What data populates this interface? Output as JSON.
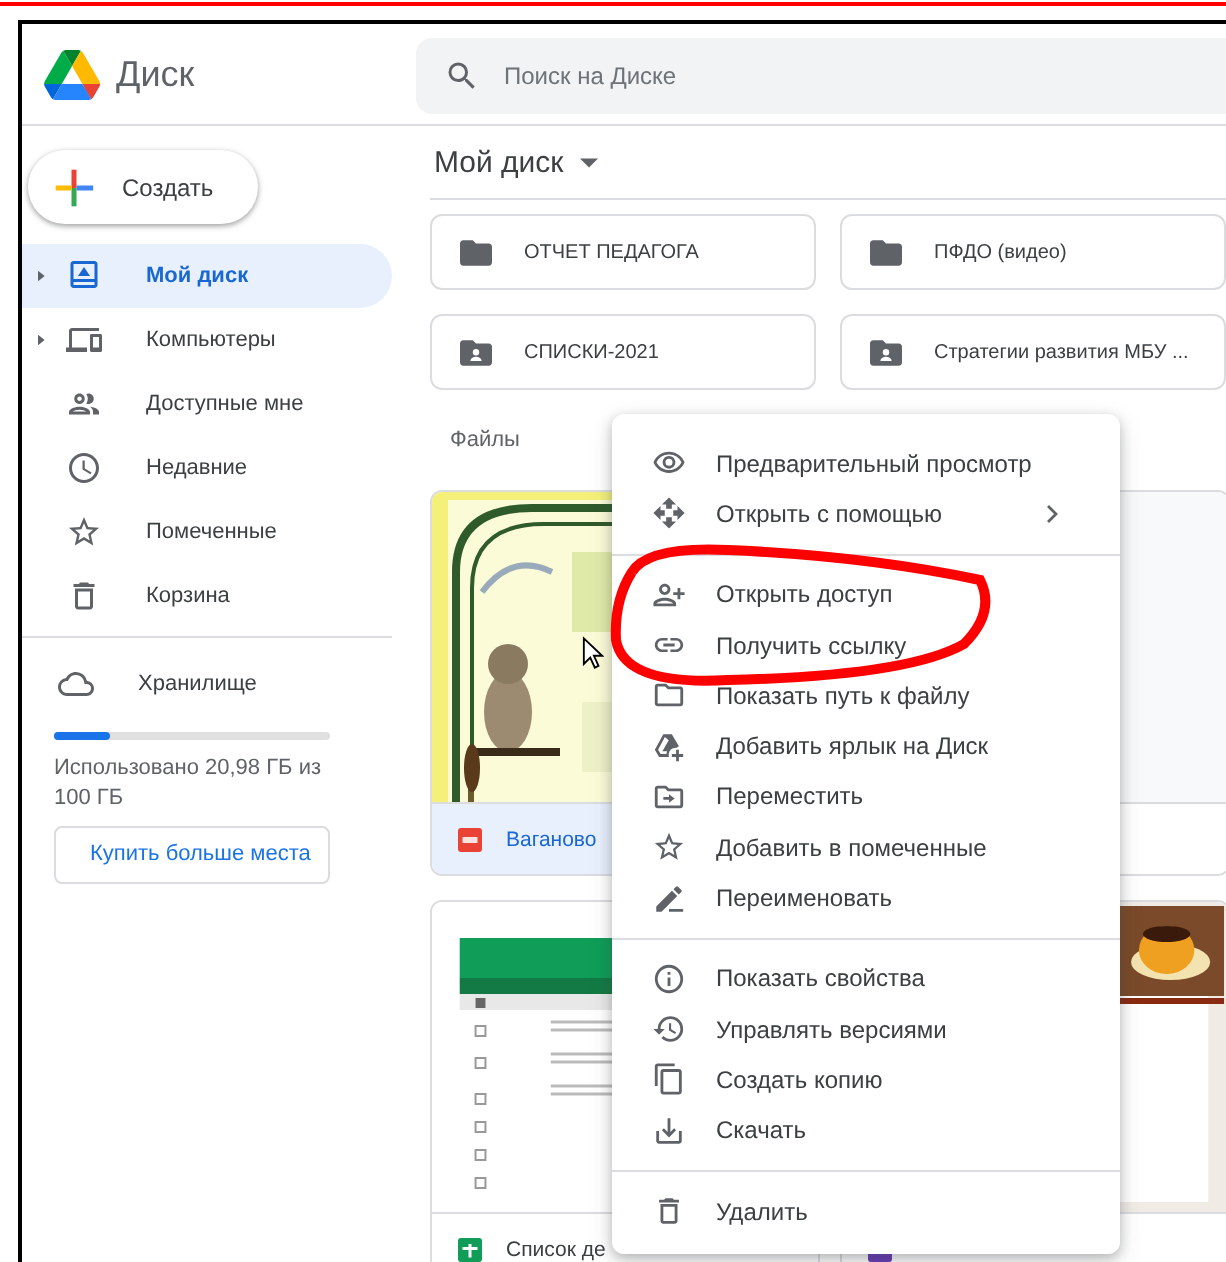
{
  "app": {
    "name": "Диск"
  },
  "search": {
    "placeholder": "Поиск на Диске"
  },
  "create_button": "Создать",
  "nav": [
    {
      "label": "Мой диск",
      "kind": "drive",
      "selected": true,
      "expandable": true
    },
    {
      "label": "Компьютеры",
      "kind": "computers",
      "selected": false,
      "expandable": true
    },
    {
      "label": "Доступные мне",
      "kind": "shared",
      "selected": false,
      "expandable": false
    },
    {
      "label": "Недавние",
      "kind": "recent",
      "selected": false,
      "expandable": false
    },
    {
      "label": "Помеченные",
      "kind": "starred",
      "selected": false,
      "expandable": false
    },
    {
      "label": "Корзина",
      "kind": "trash",
      "selected": false,
      "expandable": false
    }
  ],
  "storage": {
    "label": "Хранилище",
    "level": 0.2,
    "usage": "Использовано 20,98 ГБ из 100 ГБ",
    "buy_button": "Купить больше места"
  },
  "location": {
    "title": "Мой диск"
  },
  "folders": [
    {
      "name": "ОТЧЕТ ПЕДАГОГА",
      "shared": false
    },
    {
      "name": "ПФДО (видео)",
      "shared": false
    },
    {
      "name": "СПИСКИ-2021",
      "shared": true
    },
    {
      "name": "Стратегии развития МБУ ...",
      "shared": true
    }
  ],
  "files_heading": "Файлы",
  "files": [
    {
      "name": "Ваганово",
      "kind": "pdf",
      "selected": true
    },
    {
      "kind": "blank",
      "selected": false
    },
    {
      "name": "Список де",
      "kind": "sheet",
      "selected": false
    },
    {
      "kind": "form",
      "selected": false
    }
  ],
  "menu": {
    "groups": [
      [
        {
          "label": "Предварительный просмотр",
          "kind": "preview",
          "submenu": false
        },
        {
          "label": "Открыть с помощью",
          "kind": "open_with",
          "submenu": true
        }
      ],
      [
        {
          "label": "Открыть доступ",
          "kind": "share",
          "submenu": false
        },
        {
          "label": "Получить ссылку",
          "kind": "link",
          "submenu": false
        },
        {
          "label": "Показать путь к файлу",
          "kind": "locate",
          "submenu": false
        },
        {
          "label": "Добавить ярлык на Диск",
          "kind": "shortcut",
          "submenu": false
        },
        {
          "label": "Переместить",
          "kind": "move",
          "submenu": false
        },
        {
          "label": "Добавить в помеченные",
          "kind": "star",
          "submenu": false
        },
        {
          "label": "Переименовать",
          "kind": "rename",
          "submenu": false
        }
      ],
      [
        {
          "label": "Показать свойства",
          "kind": "details",
          "submenu": false
        },
        {
          "label": "Управлять версиями",
          "kind": "versions",
          "submenu": false
        },
        {
          "label": "Создать копию",
          "kind": "copy",
          "submenu": false
        },
        {
          "label": "Скачать",
          "kind": "download",
          "submenu": false
        }
      ],
      [
        {
          "label": "Удалить",
          "kind": "delete",
          "submenu": false
        }
      ]
    ]
  }
}
